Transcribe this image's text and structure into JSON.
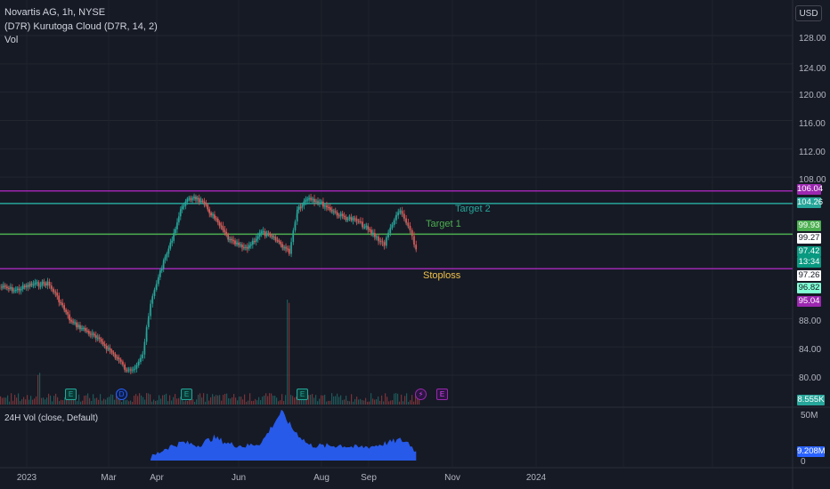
{
  "header": {
    "symbol_line": "Novartis AG, 1h, NYSE",
    "indicator_line": "(D7R) Kurutoga Cloud (D7R, 14, 2)",
    "vol_line": "Vol",
    "currency": "USD"
  },
  "price_axis": {
    "ticks": [
      "128.00",
      "124.00",
      "120.00",
      "116.00",
      "112.00",
      "108.00",
      "88.00",
      "84.00",
      "80.00"
    ],
    "tick_values": [
      128,
      124,
      120,
      116,
      112,
      108,
      88,
      84,
      80
    ]
  },
  "time_axis": {
    "labels": [
      "2023",
      "Mar",
      "Apr",
      "Jun",
      "Aug",
      "Sep",
      "Nov",
      "2024"
    ]
  },
  "levels": {
    "top_purple": {
      "price": 106.04,
      "label": "106.04",
      "color": "#9c27b0"
    },
    "target2": {
      "price": 104.26,
      "label": "104.26",
      "text": "Target 2",
      "color": "#26a69a"
    },
    "target1": {
      "price": 99.93,
      "label": "99.93",
      "text": "Target 1",
      "color": "#4caf50"
    },
    "stoploss": {
      "price": 95.04,
      "label": "95.04",
      "text": "Stoploss",
      "color": "#9c27b0"
    }
  },
  "price_tags": [
    {
      "label": "99.27",
      "bg": "#ffffff",
      "fg": "#131722"
    },
    {
      "label": "97.42",
      "bg": "#089981",
      "fg": "#ffffff"
    },
    {
      "label": "13:34",
      "bg": "#089981",
      "fg": "#ffffff"
    },
    {
      "label": "97.26",
      "bg": "#ffffff",
      "fg": "#131722"
    },
    {
      "label": "96.82",
      "bg": "#80ffd4",
      "fg": "#131722"
    }
  ],
  "volume_tag": {
    "label": "8.555K",
    "bg": "#26a69a"
  },
  "events": [
    {
      "letter": "E",
      "type": "earnings"
    },
    {
      "letter": "D",
      "type": "dividend"
    },
    {
      "letter": "E",
      "type": "earnings"
    },
    {
      "letter": "E",
      "type": "earnings"
    },
    {
      "letter": "⚡",
      "type": "split"
    },
    {
      "letter": "E",
      "type": "earnings-upcoming"
    }
  ],
  "lower_pane": {
    "title": "24H Vol (close, Default)",
    "axis_top": "50M",
    "axis_zero": "0",
    "value_tag": "9.208M"
  },
  "colors": {
    "background": "#161a25",
    "up": "#26a69a",
    "down": "#ef5350",
    "volume_area": "#2962ff"
  },
  "chart_data": {
    "type": "line",
    "description_free": true,
    "y_range": [
      78,
      130
    ],
    "close_path": [
      [
        0,
        92.5
      ],
      [
        0.02,
        92.0
      ],
      [
        0.04,
        92.8
      ],
      [
        0.06,
        93.0
      ],
      [
        0.07,
        91.5
      ],
      [
        0.09,
        87.5
      ],
      [
        0.11,
        86.2
      ],
      [
        0.13,
        84.5
      ],
      [
        0.15,
        82.2
      ],
      [
        0.16,
        80.5
      ],
      [
        0.17,
        81.2
      ],
      [
        0.18,
        83.0
      ],
      [
        0.19,
        90.0
      ],
      [
        0.2,
        94.0
      ],
      [
        0.215,
        98.5
      ],
      [
        0.23,
        104.0
      ],
      [
        0.245,
        105.3
      ],
      [
        0.26,
        103.8
      ],
      [
        0.275,
        101.5
      ],
      [
        0.29,
        99.0
      ],
      [
        0.31,
        97.8
      ],
      [
        0.33,
        100.2
      ],
      [
        0.35,
        99.0
      ],
      [
        0.365,
        97.4
      ],
      [
        0.375,
        103.5
      ],
      [
        0.39,
        105.2
      ],
      [
        0.41,
        104.0
      ],
      [
        0.43,
        102.5
      ],
      [
        0.45,
        101.8
      ],
      [
        0.46,
        101.0
      ],
      [
        0.475,
        99.5
      ],
      [
        0.485,
        98.5
      ],
      [
        0.495,
        101.5
      ],
      [
        0.505,
        103.2
      ],
      [
        0.515,
        101.0
      ],
      [
        0.525,
        97.8
      ]
    ],
    "volume_24h": [
      [
        0.19,
        0.05
      ],
      [
        0.21,
        0.25
      ],
      [
        0.23,
        0.35
      ],
      [
        0.25,
        0.3
      ],
      [
        0.27,
        0.45
      ],
      [
        0.29,
        0.32
      ],
      [
        0.31,
        0.28
      ],
      [
        0.33,
        0.35
      ],
      [
        0.355,
        0.95
      ],
      [
        0.37,
        0.6
      ],
      [
        0.39,
        0.3
      ],
      [
        0.41,
        0.28
      ],
      [
        0.43,
        0.3
      ],
      [
        0.45,
        0.25
      ],
      [
        0.47,
        0.28
      ],
      [
        0.49,
        0.35
      ],
      [
        0.505,
        0.4
      ],
      [
        0.515,
        0.35
      ],
      [
        0.525,
        0.18
      ]
    ]
  }
}
